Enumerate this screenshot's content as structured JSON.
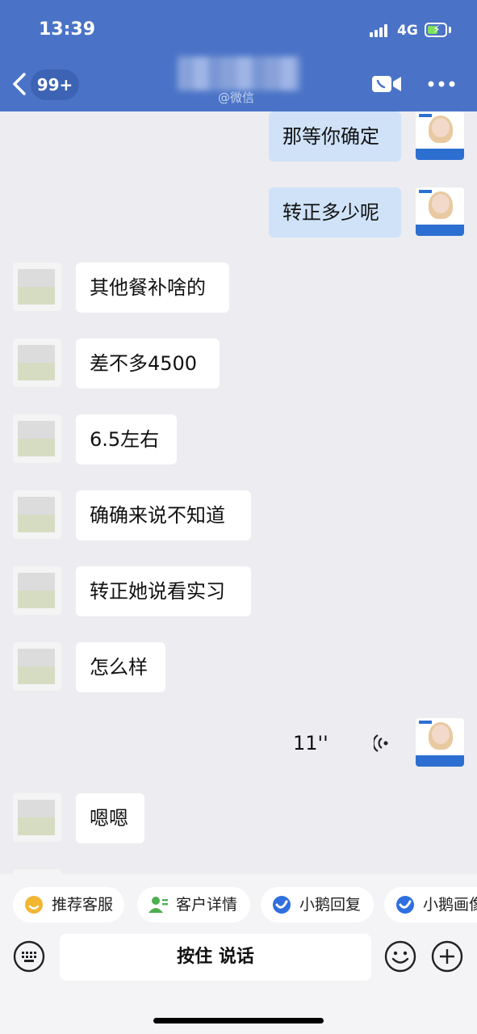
{
  "status_bar": {
    "time": "13:39",
    "network": "4G"
  },
  "nav": {
    "unread_badge": "99+",
    "subtitle": "@微信",
    "colors": {
      "header_bg": "#4a73c7",
      "outgoing_bubble": "#cfe2f8",
      "chat_bg": "#ececf1"
    }
  },
  "messages": [
    {
      "side": "out",
      "type": "text",
      "text": "那等你确定"
    },
    {
      "side": "out",
      "type": "text",
      "text": "转正多少呢"
    },
    {
      "side": "in",
      "type": "text",
      "text": "其他餐补啥的"
    },
    {
      "side": "in",
      "type": "text",
      "text": "差不多4500"
    },
    {
      "side": "in",
      "type": "text",
      "text": "6.5左右"
    },
    {
      "side": "in",
      "type": "text",
      "text": "确确来说不知道"
    },
    {
      "side": "in",
      "type": "text",
      "text": "转正她说看实习"
    },
    {
      "side": "in",
      "type": "text",
      "text": "怎么样"
    },
    {
      "side": "out",
      "type": "voice",
      "text": "11''"
    },
    {
      "side": "in",
      "type": "text",
      "text": "嗯嗯"
    }
  ],
  "quick_actions": [
    {
      "label": "推荐客服",
      "icon": "emoji-smile-icon"
    },
    {
      "label": "客户详情",
      "icon": "contact-person-icon"
    },
    {
      "label": "小鹅回复",
      "icon": "goose-icon"
    },
    {
      "label": "小鹅画像",
      "icon": "goose-icon"
    }
  ],
  "input_bar": {
    "talk_label": "按住 说话"
  }
}
